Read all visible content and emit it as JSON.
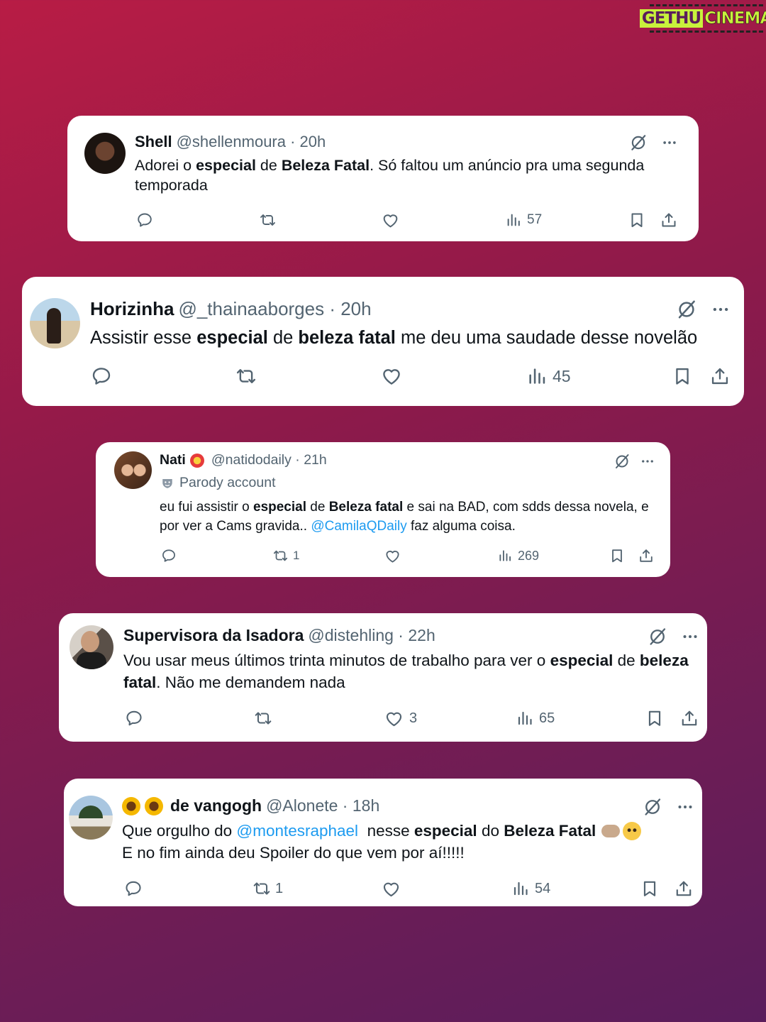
{
  "watermark": {
    "part1": "GETHU",
    "part2": "CINEMA"
  },
  "tweets": [
    {
      "name": "Shell",
      "meta": "@shellenmoura · 20h",
      "body": [
        "Adorei o ",
        "especial",
        " de ",
        "Beleza Fatal",
        ". Só faltou um anúncio pra uma segunda temporada"
      ],
      "views": "57"
    },
    {
      "name": "Horizinha",
      "meta": "@_thainaaborges · 20h",
      "body": [
        "Assistir esse ",
        "especial",
        " de ",
        "beleza fatal",
        " me deu uma saudade desse novelão"
      ],
      "views": "45"
    },
    {
      "name": "Nati",
      "meta": "@natidodaily · 21h",
      "badge": "Parody account",
      "body": [
        "eu fui assistir o ",
        "especial",
        " de ",
        "Beleza fatal",
        " e sai na BAD, com sdds dessa novela, e por ver a Cams gravida.. ",
        "@CamilaQDaily",
        " faz alguma coisa."
      ],
      "retweets": "1",
      "views": "269"
    },
    {
      "name": "Supervisora da Isadora",
      "meta": "@distehling · 22h",
      "body": [
        "Vou usar meus últimos trinta minutos de trabalho para ver o ",
        "especial",
        " de ",
        "beleza fatal",
        ". Não me demandem nada"
      ],
      "likes": "3",
      "views": "65"
    },
    {
      "name": "de vangogh",
      "meta": "@Alonete · 18h",
      "body1": [
        "Que orgulho do ",
        "@montesraphael",
        "  nesse ",
        "especial",
        " do ",
        "Beleza Fatal"
      ],
      "body2": "E no fim ainda deu Spoiler do que vem por aí!!!!!",
      "retweets": "1",
      "views": "54"
    }
  ],
  "icons": [
    "reply-icon",
    "retweet-icon",
    "like-icon",
    "views-icon",
    "bookmark-icon",
    "share-icon",
    "grok-icon",
    "more-icon"
  ]
}
